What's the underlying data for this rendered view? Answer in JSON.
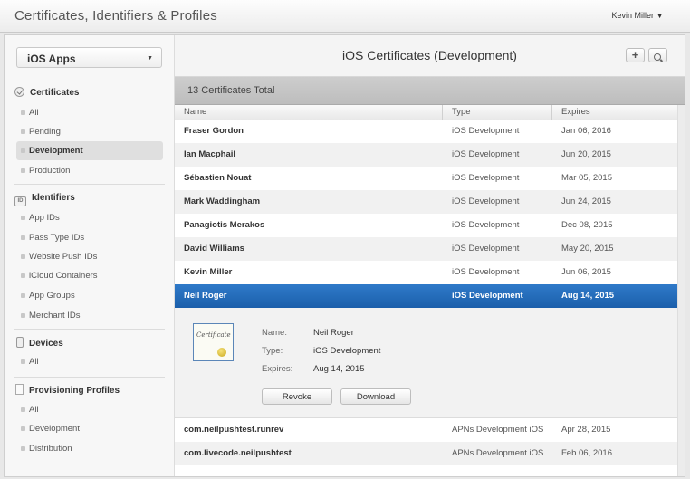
{
  "app": {
    "title": "Certificates, Identifiers & Profiles",
    "user": "Kevin Miller"
  },
  "sidebar": {
    "selector_value": "iOS Apps",
    "sections": [
      {
        "title": "Certificates",
        "icon": "certificate-icon",
        "items": [
          "All",
          "Pending",
          "Development",
          "Production"
        ]
      },
      {
        "title": "Identifiers",
        "icon": "id-icon",
        "items": [
          "App IDs",
          "Pass Type IDs",
          "Website Push IDs",
          "iCloud Containers",
          "App Groups",
          "Merchant IDs"
        ]
      },
      {
        "title": "Devices",
        "icon": "device-icon",
        "items": [
          "All"
        ]
      },
      {
        "title": "Provisioning Profiles",
        "icon": "profile-icon",
        "items": [
          "All",
          "Development",
          "Distribution"
        ]
      }
    ],
    "active_item": "Development"
  },
  "main": {
    "title": "iOS Certificates (Development)",
    "add_label": "+",
    "total": "13 Certificates Total",
    "columns": [
      "Name",
      "Type",
      "Expires"
    ],
    "rows": [
      {
        "name": "Fraser Gordon",
        "type": "iOS Development",
        "expires": "Jan 06, 2016"
      },
      {
        "name": "Ian Macphail",
        "type": "iOS Development",
        "expires": "Jun 20, 2015"
      },
      {
        "name": "Sébastien Nouat",
        "type": "iOS Development",
        "expires": "Mar 05, 2015"
      },
      {
        "name": "Mark Waddingham",
        "type": "iOS Development",
        "expires": "Jun 24, 2015"
      },
      {
        "name": "Panagiotis Merakos",
        "type": "iOS Development",
        "expires": "Dec 08, 2015"
      },
      {
        "name": "David Williams",
        "type": "iOS Development",
        "expires": "May 20, 2015"
      },
      {
        "name": "Kevin Miller",
        "type": "iOS Development",
        "expires": "Jun 06, 2015"
      },
      {
        "name": "Neil Roger",
        "type": "iOS Development",
        "expires": "Aug 14, 2015"
      }
    ],
    "rows_after": [
      {
        "name": "com.neilpushtest.runrev",
        "type": "APNs Development iOS",
        "expires": "Apr 28, 2015"
      },
      {
        "name": "com.livecode.neilpushtest",
        "type": "APNs Development iOS",
        "expires": "Feb 06, 2016"
      }
    ],
    "detail": {
      "labels": {
        "name": "Name:",
        "type": "Type:",
        "expires": "Expires:"
      },
      "values": {
        "name": "Neil Roger",
        "type": "iOS Development",
        "expires": "Aug 14, 2015"
      },
      "cert_image_text": "Certificate",
      "revoke_label": "Revoke",
      "download_label": "Download"
    }
  }
}
